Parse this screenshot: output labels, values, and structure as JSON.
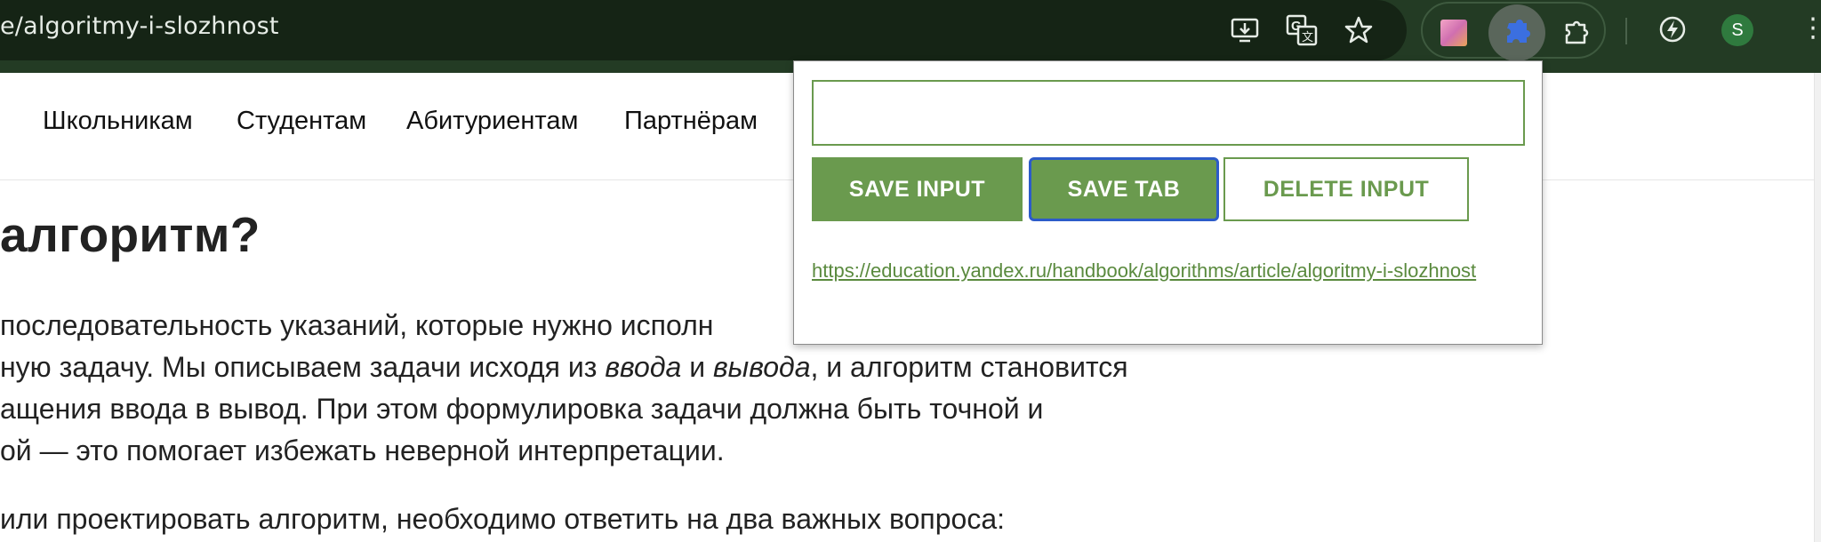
{
  "browser": {
    "url_fragment": "e/algoritmy-i-slozhnost",
    "avatar_letter": "S",
    "icons": [
      "install-app-icon",
      "translate-icon",
      "bookmark-star-icon",
      "extension-gradient-icon",
      "pinned-extension-icon",
      "extensions-puzzle-icon",
      "performance-icon",
      "avatar",
      "menu-icon"
    ],
    "theme_color": "#233b24"
  },
  "site_nav": {
    "items": [
      "Школьникам",
      "Студентам",
      "Абитуриентам",
      "Партнёрам"
    ]
  },
  "article": {
    "heading": "алгоритм?",
    "lines": [
      {
        "before": "последовательность указаний, которые нужно исполн",
        "italic1": "",
        "middle": "",
        "italic2": "",
        "after": ""
      },
      {
        "before": "ную задачу. Мы описываем задачи исходя из ",
        "italic1": "ввода",
        "middle": " и ",
        "italic2": "вывода",
        "after": ", и алгоритм становится"
      },
      {
        "before": "ащения ввода в вывод. При этом формулировка задачи должна быть точной и",
        "italic1": "",
        "middle": "",
        "italic2": "",
        "after": ""
      },
      {
        "before": "ой — это помогает избежать неверной интерпретации.",
        "italic1": "",
        "middle": "",
        "italic2": "",
        "after": ""
      },
      {
        "before": "или проектировать алгоритм, необходимо ответить на два важных вопроса:",
        "italic1": "",
        "middle": "",
        "italic2": "",
        "after": ""
      }
    ]
  },
  "popup": {
    "input_value": "",
    "save_input_label": "SAVE INPUT",
    "save_tab_label": "SAVE TAB",
    "delete_input_label": "DELETE INPUT",
    "saved_link": "https://education.yandex.ru/handbook/algorithms/article/algoritmy-i-slozhnost",
    "accent_color": "#6a9a4e",
    "focus_color": "#2c5bc9"
  }
}
